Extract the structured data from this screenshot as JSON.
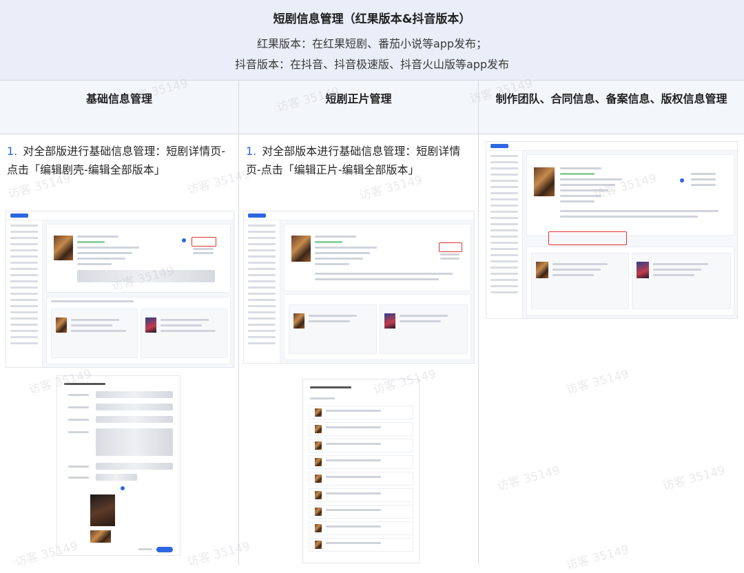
{
  "header": {
    "title": "短剧信息管理（红果版本&抖音版本）",
    "line1": "红果版本：在红果短剧、番茄小说等app发布；",
    "line2": "抖音版本：在抖音、抖音极速版、抖音火山版等app发布"
  },
  "columns": [
    {
      "title": "基础信息管理",
      "item_num": "1.",
      "item_text": "对全部版进行基础信息管理：短剧详情页-点击「编辑剧壳-编辑全部版本」"
    },
    {
      "title": "短剧正片管理",
      "item_num": "1.",
      "item_text": "对全部版本进行基础信息管理：短剧详情页-点击「编辑正片-编辑全部版本」"
    },
    {
      "title": "制作团队、合同信息、备案信息、版权信息管理",
      "item_num": "",
      "item_text": ""
    }
  ],
  "watermark": "访客 35149",
  "colors": {
    "header_bg": "#e9eef8",
    "accent": "#2b63d9",
    "highlight": "#e0342c"
  }
}
